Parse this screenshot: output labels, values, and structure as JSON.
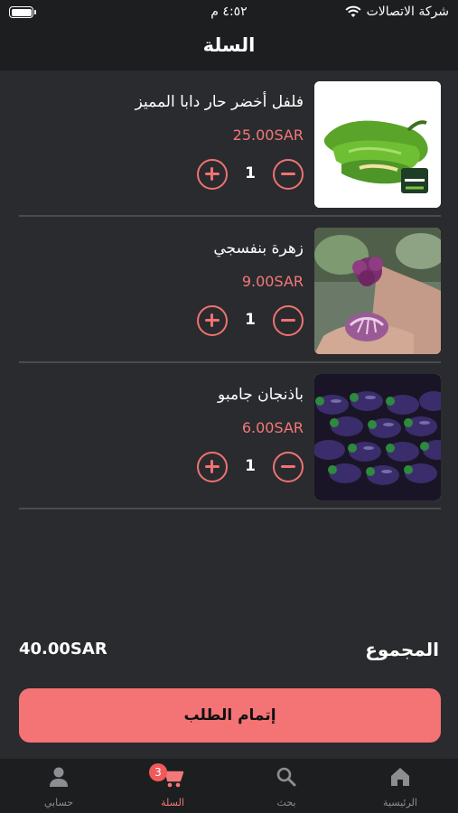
{
  "status_bar": {
    "time": "٤:٥٢ م",
    "carrier": "شركة الاتصالات",
    "wifi_icon": "wifi-icon",
    "battery_icon": "battery-icon"
  },
  "header": {
    "title": "السلة"
  },
  "cart": {
    "items": [
      {
        "name": "فلفل أخضر حار دابا المميز",
        "price": "25.00SAR",
        "quantity": "1",
        "image": "green-peppers-photo"
      },
      {
        "name": "زهرة بنفسجي",
        "price": "9.00SAR",
        "quantity": "1",
        "image": "purple-cauliflower-photo"
      },
      {
        "name": "باذنجان جامبو",
        "price": "6.00SAR",
        "quantity": "1",
        "image": "eggplants-photo"
      }
    ],
    "total_label": "المجموع",
    "total_value": "40.00SAR",
    "checkout_label": "إتمام الطلب"
  },
  "tabbar": {
    "tabs": [
      {
        "label": "الرئيسية",
        "icon": "home-icon"
      },
      {
        "label": "بحث",
        "icon": "search-icon"
      },
      {
        "label": "السلة",
        "icon": "cart-icon",
        "badge": "3",
        "active": true
      },
      {
        "label": "حسابي",
        "icon": "user-icon"
      }
    ]
  },
  "colors": {
    "accent": "#f47375",
    "background": "#2a2b2e",
    "bar": "#1d1e20"
  }
}
